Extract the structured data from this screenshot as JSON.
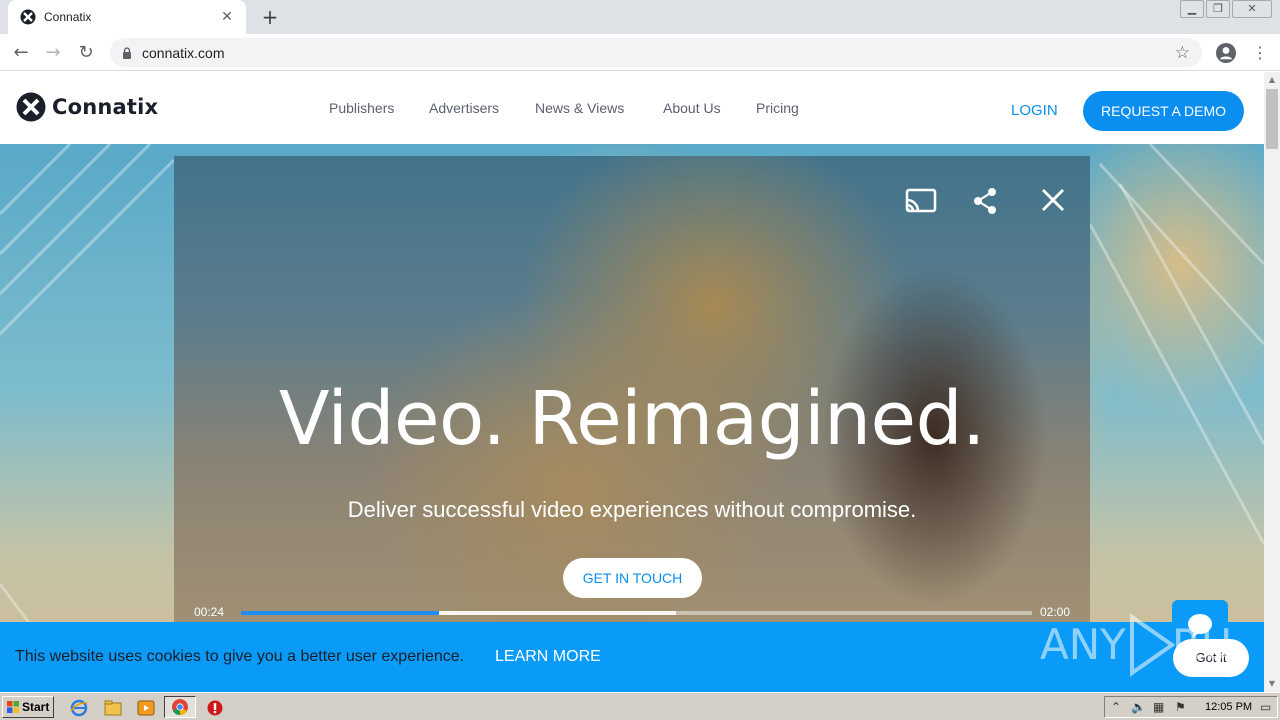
{
  "browser": {
    "tab_title": "Connatix",
    "url": "connatix.com",
    "new_tab_symbol": "+"
  },
  "site": {
    "brand": "Connatix",
    "nav": [
      "Publishers",
      "Advertisers",
      "News & Views",
      "About Us",
      "Pricing"
    ],
    "login_label": "LOGIN",
    "demo_label": "REQUEST A DEMO",
    "accent_color": "#0a8ff0"
  },
  "hero": {
    "title": "Video. Reimagined.",
    "subtitle": "Deliver successful video experiences without compromise.",
    "cta_label": "GET IN TOUCH"
  },
  "video_player": {
    "current_time": "00:24",
    "total_time": "02:00",
    "played_fraction": 0.25,
    "buffered_fraction": 0.55,
    "icons": [
      "cast-icon",
      "share-icon",
      "close-icon"
    ]
  },
  "cookie_banner": {
    "text": "This website uses cookies to give you a better user experience.",
    "learn_more": "LEARN MORE",
    "accept_label": "Got it"
  },
  "watermark": "ANY RUN",
  "taskbar": {
    "start_label": "Start",
    "clock": "12:05 PM"
  }
}
